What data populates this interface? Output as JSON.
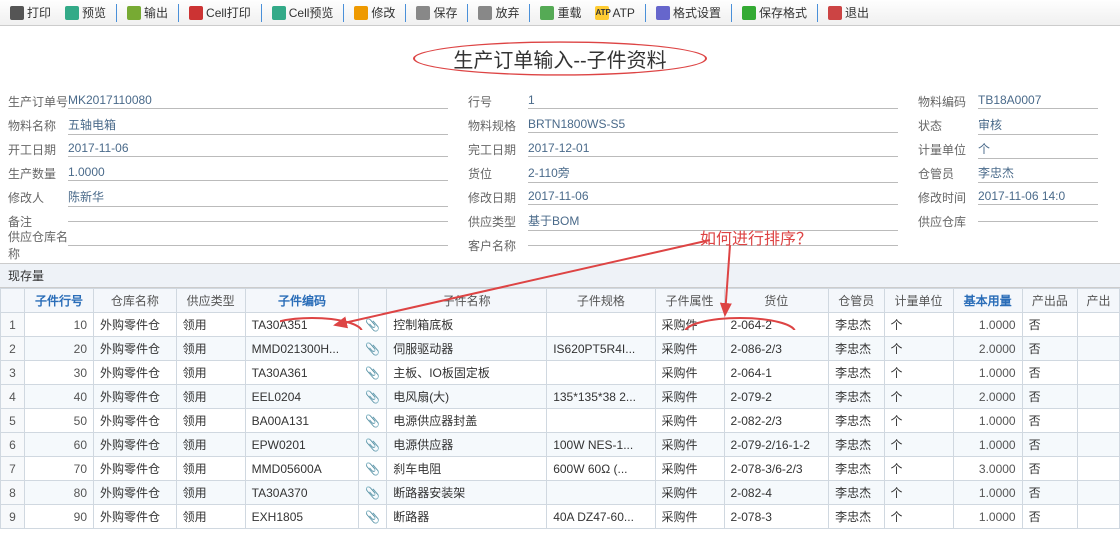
{
  "toolbar": [
    {
      "label": "打印",
      "icon": "#555"
    },
    {
      "label": "预览",
      "icon": "#3a8"
    },
    {
      "sep": true
    },
    {
      "label": "输出",
      "icon": "#7a3"
    },
    {
      "sep": true
    },
    {
      "label": "Cell打印",
      "icon": "#c33"
    },
    {
      "sep": true
    },
    {
      "label": "Cell预览",
      "icon": "#3a8"
    },
    {
      "sep": true
    },
    {
      "label": "修改",
      "icon": "#e90"
    },
    {
      "sep": true
    },
    {
      "label": "保存",
      "icon": "#888"
    },
    {
      "sep": true
    },
    {
      "label": "放弃",
      "icon": "#888"
    },
    {
      "sep": true
    },
    {
      "label": "重载",
      "icon": "#5a5"
    },
    {
      "label": "ATP",
      "icon": "#fa0",
      "textIcon": "ATP"
    },
    {
      "sep": true
    },
    {
      "label": "格式设置",
      "icon": "#66c"
    },
    {
      "sep": true
    },
    {
      "label": "保存格式",
      "icon": "#3a3"
    },
    {
      "sep": true
    },
    {
      "label": "退出",
      "icon": "#c44"
    }
  ],
  "title": "生产订单输入--子件资料",
  "annotation_sort": "如何进行排序？",
  "form": {
    "col1": [
      {
        "label": "生产订单号",
        "value": "MK2017110080"
      },
      {
        "label": "物料名称",
        "value": "五轴电箱"
      },
      {
        "label": "开工日期",
        "value": "2017-11-06"
      },
      {
        "label": "生产数量",
        "value": "1.0000"
      },
      {
        "label": "修改人",
        "value": "陈新华"
      },
      {
        "label": "备注",
        "value": ""
      },
      {
        "label": "供应仓库名称",
        "value": ""
      }
    ],
    "col2": [
      {
        "label": "行号",
        "value": "1"
      },
      {
        "label": "物料规格",
        "value": "BRTN1800WS-S5"
      },
      {
        "label": "完工日期",
        "value": "2017-12-01"
      },
      {
        "label": "货位",
        "value": "2-110旁"
      },
      {
        "label": "修改日期",
        "value": "2017-11-06"
      },
      {
        "label": "供应类型",
        "value": "基于BOM"
      },
      {
        "label": "客户名称",
        "value": ""
      }
    ],
    "col3": [
      {
        "label": "物料编码",
        "value": "TB18A0007"
      },
      {
        "label": "状态",
        "value": "审核"
      },
      {
        "label": "计量单位",
        "value": "个"
      },
      {
        "label": "仓管员",
        "value": "李忠杰"
      },
      {
        "label": "修改时间",
        "value": "2017-11-06 14:0"
      },
      {
        "label": "供应仓库",
        "value": ""
      }
    ]
  },
  "tab_label": "现存量",
  "columns": [
    {
      "label": "",
      "key": "idx"
    },
    {
      "label": "子件行号",
      "key": "line",
      "cls": "blue"
    },
    {
      "label": "仓库名称",
      "key": "wh"
    },
    {
      "label": "供应类型",
      "key": "st"
    },
    {
      "label": "子件编码",
      "key": "code",
      "cls": "blue"
    },
    {
      "label": "",
      "key": "clip"
    },
    {
      "label": "子件名称",
      "key": "name"
    },
    {
      "label": "子件规格",
      "key": "spec"
    },
    {
      "label": "子件属性",
      "key": "attr"
    },
    {
      "label": "货位",
      "key": "loc"
    },
    {
      "label": "仓管员",
      "key": "keeper"
    },
    {
      "label": "计量单位",
      "key": "uom"
    },
    {
      "label": "基本用量",
      "key": "qty",
      "cls": "blue"
    },
    {
      "label": "产出品",
      "key": "out"
    },
    {
      "label": "产出",
      "key": "out2"
    }
  ],
  "rows": [
    {
      "idx": "1",
      "line": "10",
      "wh": "外购零件仓",
      "st": "领用",
      "code": "TA30A351",
      "name": "控制箱底板",
      "spec": "",
      "attr": "采购件",
      "loc": "2-064-2",
      "keeper": "李忠杰",
      "uom": "个",
      "qty": "1.0000",
      "out": "否"
    },
    {
      "idx": "2",
      "line": "20",
      "wh": "外购零件仓",
      "st": "领用",
      "code": "MMD021300H...",
      "name": "伺服驱动器",
      "spec": "IS620PT5R4I...",
      "attr": "采购件",
      "loc": "2-086-2/3",
      "keeper": "李忠杰",
      "uom": "个",
      "qty": "2.0000",
      "out": "否"
    },
    {
      "idx": "3",
      "line": "30",
      "wh": "外购零件仓",
      "st": "领用",
      "code": "TA30A361",
      "name": "主板、IO板固定板",
      "spec": "",
      "attr": "采购件",
      "loc": "2-064-1",
      "keeper": "李忠杰",
      "uom": "个",
      "qty": "1.0000",
      "out": "否"
    },
    {
      "idx": "4",
      "line": "40",
      "wh": "外购零件仓",
      "st": "领用",
      "code": "EEL0204",
      "name": "电风扇(大)",
      "spec": "135*135*38 2...",
      "attr": "采购件",
      "loc": "2-079-2",
      "keeper": "李忠杰",
      "uom": "个",
      "qty": "2.0000",
      "out": "否"
    },
    {
      "idx": "5",
      "line": "50",
      "wh": "外购零件仓",
      "st": "领用",
      "code": "BA00A131",
      "name": "电源供应器封盖",
      "spec": "",
      "attr": "采购件",
      "loc": "2-082-2/3",
      "keeper": "李忠杰",
      "uom": "个",
      "qty": "1.0000",
      "out": "否"
    },
    {
      "idx": "6",
      "line": "60",
      "wh": "外购零件仓",
      "st": "领用",
      "code": "EPW0201",
      "name": "电源供应器",
      "spec": "100W NES-1...",
      "attr": "采购件",
      "loc": "2-079-2/16-1-2",
      "keeper": "李忠杰",
      "uom": "个",
      "qty": "1.0000",
      "out": "否"
    },
    {
      "idx": "7",
      "line": "70",
      "wh": "外购零件仓",
      "st": "领用",
      "code": "MMD05600A",
      "name": "刹车电阻",
      "spec": "600W 60Ω (...",
      "attr": "采购件",
      "loc": "2-078-3/6-2/3",
      "keeper": "李忠杰",
      "uom": "个",
      "qty": "3.0000",
      "out": "否"
    },
    {
      "idx": "8",
      "line": "80",
      "wh": "外购零件仓",
      "st": "领用",
      "code": "TA30A370",
      "name": "断路器安装架",
      "spec": "",
      "attr": "采购件",
      "loc": "2-082-4",
      "keeper": "李忠杰",
      "uom": "个",
      "qty": "1.0000",
      "out": "否"
    },
    {
      "idx": "9",
      "line": "90",
      "wh": "外购零件仓",
      "st": "领用",
      "code": "EXH1805",
      "name": "断路器",
      "spec": "40A DZ47-60...",
      "attr": "采购件",
      "loc": "2-078-3",
      "keeper": "李忠杰",
      "uom": "个",
      "qty": "1.0000",
      "out": "否"
    }
  ]
}
